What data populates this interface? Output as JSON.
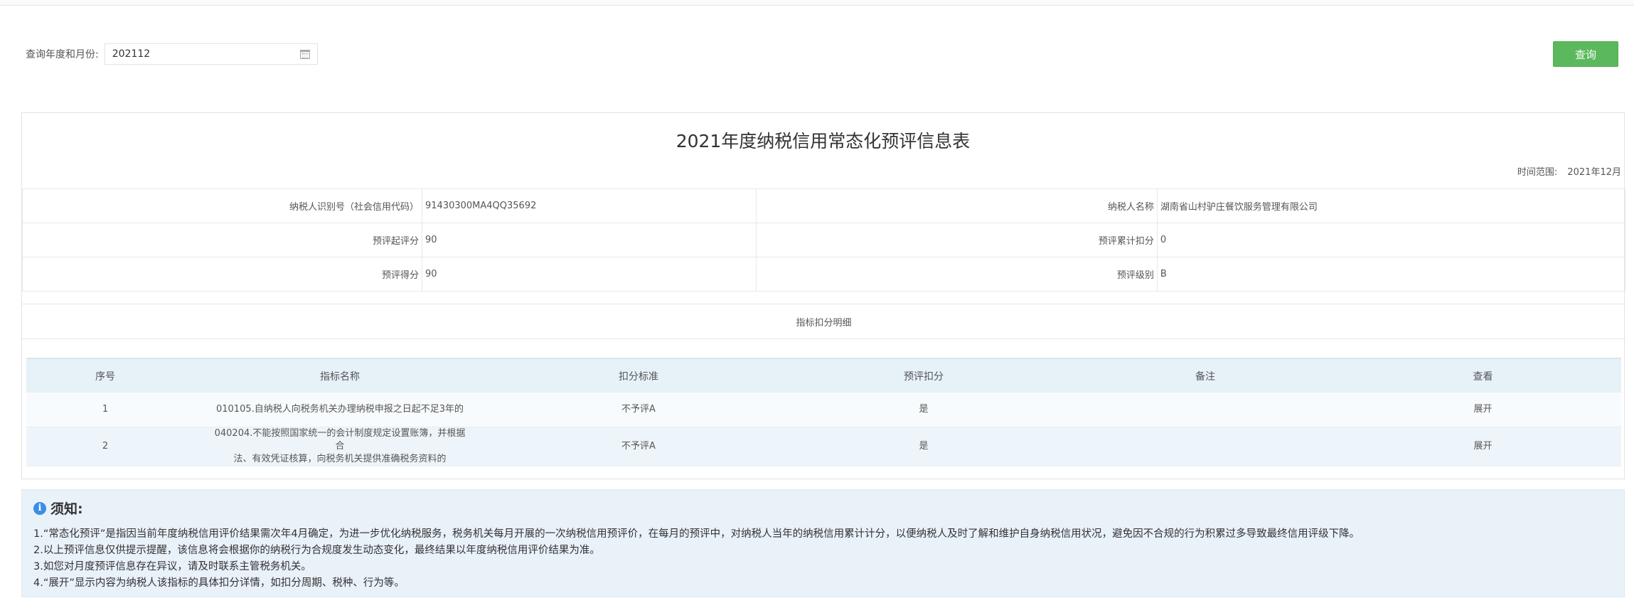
{
  "query": {
    "label": "查询年度和月份:",
    "value": "202112",
    "button": "查询"
  },
  "panel": {
    "title": "2021年度纳税信用常态化预评信息表",
    "time_range_label": "时间范围:",
    "time_range_value": "2021年12月"
  },
  "info": {
    "taxpayer_id_label": "纳税人识别号（社会信用代码）",
    "taxpayer_id": "91430300MA4QQ35692",
    "taxpayer_name_label": "纳税人名称",
    "taxpayer_name": "湖南省山村驴庄餐饮服务管理有限公司",
    "start_score_label": "预评起评分",
    "start_score": "90",
    "deduction_total_label": "预评累计扣分",
    "deduction_total": "0",
    "score_label": "预评得分",
    "score": "90",
    "level_label": "预评级别",
    "level": "B"
  },
  "detail": {
    "header": "指标扣分明细",
    "columns": [
      "序号",
      "指标名称",
      "扣分标准",
      "预评扣分",
      "备注",
      "查看"
    ],
    "rows": [
      {
        "no": "1",
        "name": "010105.自纳税人向税务机关办理纳税申报之日起不足3年的",
        "name2": "",
        "standard": "不予评A",
        "deduct": "是",
        "remark": "",
        "view": "展开"
      },
      {
        "no": "2",
        "name": "040204.不能按照国家统一的会计制度规定设置账簿，并根据合",
        "name2": "法、有效凭证核算，向税务机关提供准确税务资料的",
        "standard": "不予评A",
        "deduct": "是",
        "remark": "",
        "view": "展开"
      }
    ]
  },
  "notice": {
    "title": "须知:",
    "lines": [
      "1.“常态化预评”是指因当前年度纳税信用评价结果需次年4月确定，为进一步优化纳税服务，税务机关每月开展的一次纳税信用预评价，在每月的预评中，对纳税人当年的纳税信用累计计分，以便纳税人及时了解和维护自身纳税信用状况，避免因不合规的行为积累过多导致最终信用评级下降。",
      "2.以上预评信息仅供提示提醒，该信息将会根据你的纳税行为合规度发生动态变化，最终结果以年度纳税信用评价结果为准。",
      "3.如您对月度预评信息存在异议，请及时联系主管税务机关。",
      "4.“展开”显示内容为纳税人该指标的具体扣分详情，如扣分周期、税种、行为等。"
    ]
  },
  "colors": {
    "accent_green": "#5cb85c",
    "header_blue": "#e6f1f8",
    "notice_bg": "#e9f1f9",
    "info_icon": "#3a8ee6"
  }
}
